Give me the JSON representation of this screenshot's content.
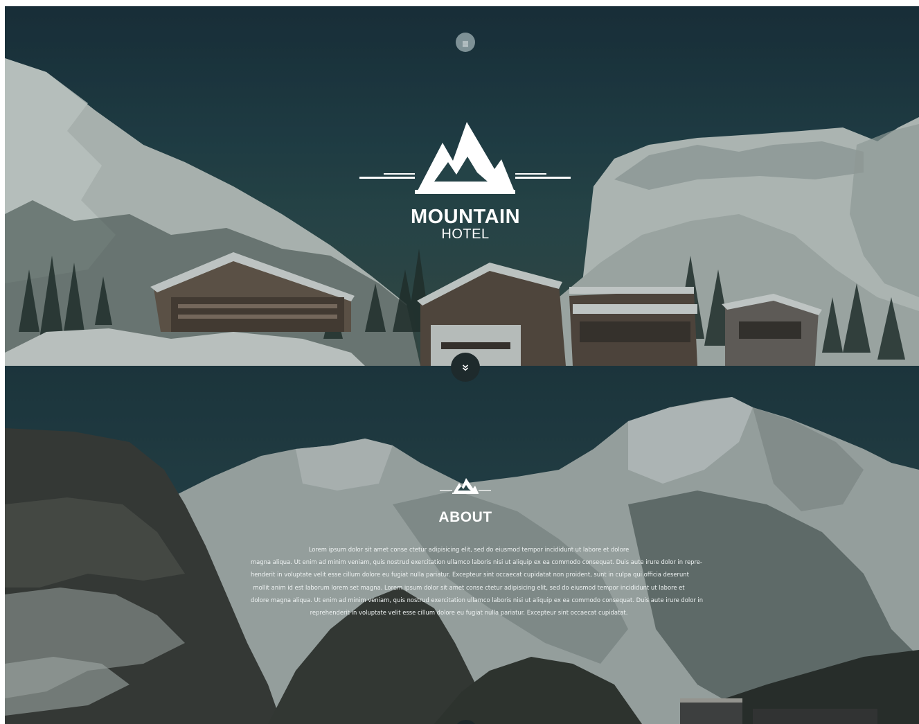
{
  "colors": {
    "accent": "#ffffff",
    "button_dark": "#1e2a2c",
    "menu_button": "#a0b2b6"
  },
  "header": {
    "menu_icon": "hamburger-icon"
  },
  "hero": {
    "logo_icon": "mountain-logo-icon",
    "title": "MOUNTAIN",
    "subtitle": "HOTEL",
    "scroll_icon": "double-chevron-down-icon"
  },
  "about": {
    "icon": "mountain-small-icon",
    "title": "ABOUT",
    "lines": [
      "Lorem ipsum dolor sit amet conse ctetur adipisicing elit, sed do eiusmod tempor incididunt ut labore et dolore",
      "magna aliqua. Ut enim ad minim veniam, quis nostrud exercitation ullamco laboris nisi ut aliquip ex ea commodo consequat. Duis aute irure dolor in repre-",
      "henderit in voluptate velit esse cillum dolore eu fugiat nulla pariatur. Excepteur sint occaecat cupidatat non proident, sunt in culpa qui officia deserunt",
      "mollit anim id est laborum lorem set magna. Lorem ipsum dolor sit amet conse ctetur adipisicing elit, sed do eiusmod tempor incididunt ut labore et",
      "dolore magna aliqua. Ut enim ad minim veniam, quis nostrud exercitation ullamco laboris nisi ut aliquip ex ea commodo consequat. Duis aute irure dolor in",
      "reprehenderit in voluptate velit esse cillum dolore eu fugiat nulla pariatur. Excepteur sint occaecat cupidatat."
    ]
  }
}
